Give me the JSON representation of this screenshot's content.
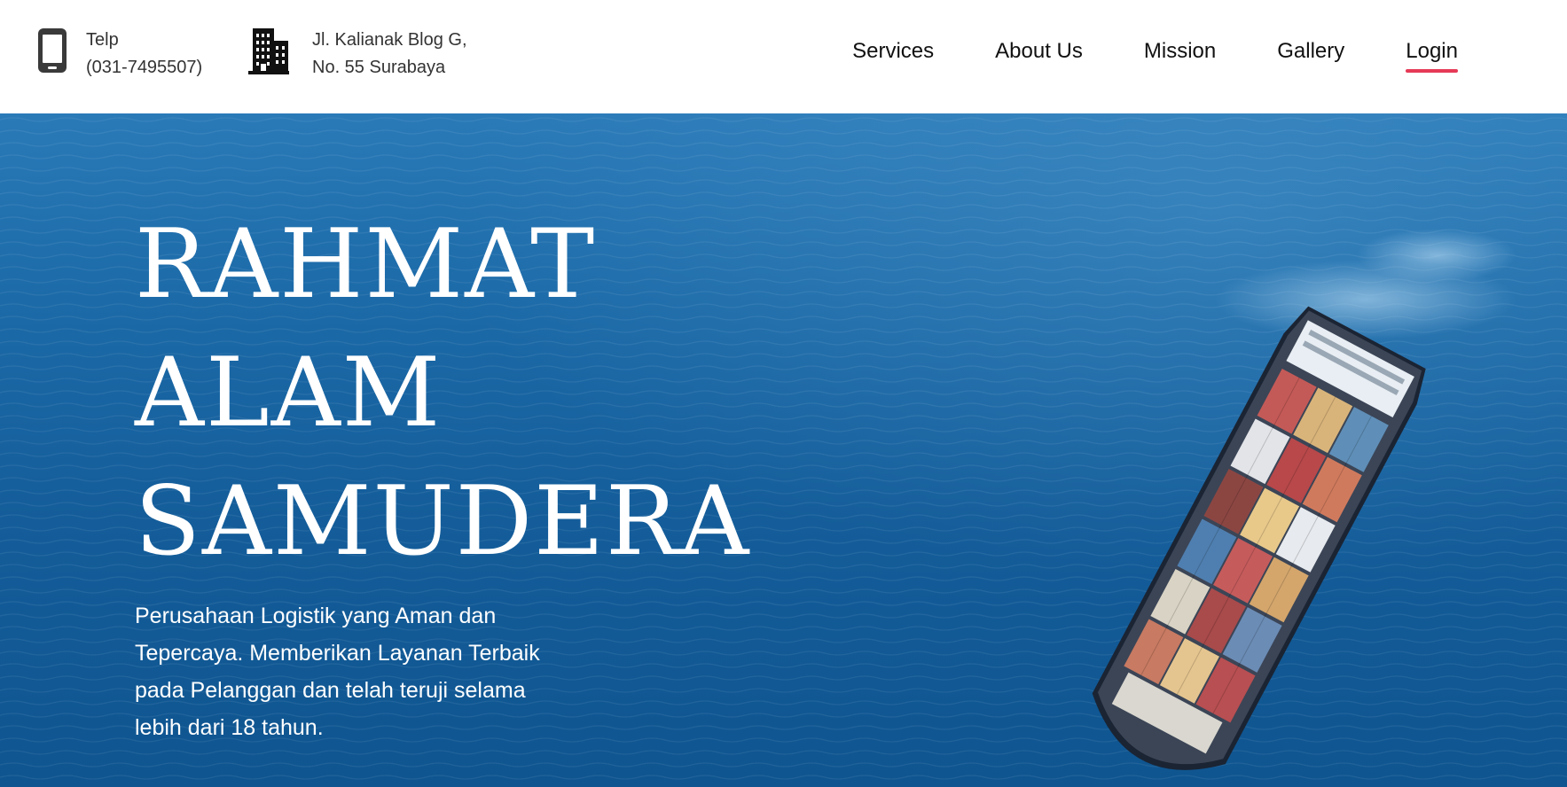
{
  "header": {
    "phone": {
      "label": "Telp",
      "number": "(031-7495507)",
      "icon": "smartphone-icon"
    },
    "address": {
      "line1": "Jl. Kalianak Blog G,",
      "line2": "No. 55 Surabaya",
      "icon": "building-icon"
    },
    "nav": [
      {
        "label": "Services",
        "active": false
      },
      {
        "label": "About Us",
        "active": false
      },
      {
        "label": "Mission",
        "active": false
      },
      {
        "label": "Gallery",
        "active": false
      },
      {
        "label": "Login",
        "active": true
      }
    ]
  },
  "hero": {
    "title_lines": [
      "RAHMAT",
      "ALAM",
      "SAMUDERA"
    ],
    "description": "Perusahaan Logistik yang Aman dan Tepercaya. Memberikan Layanan Terbaik pada Pelanggan dan telah teruji selama lebih dari 18 tahun."
  },
  "colors": {
    "accent_underline": "#e63a57",
    "hero_blue": "#145d9a",
    "text_dark": "#111111"
  }
}
